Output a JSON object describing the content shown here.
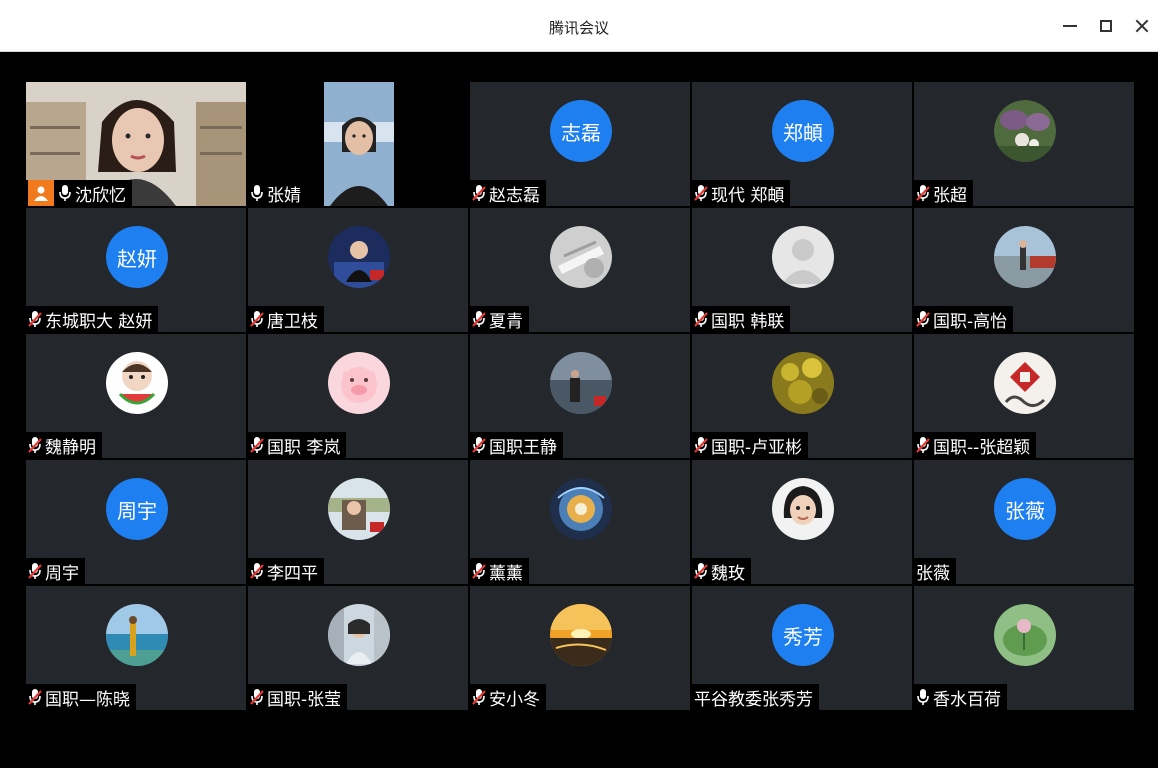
{
  "window": {
    "title": "腾讯会议"
  },
  "participants": [
    {
      "name": "沈欣忆",
      "mic": "on",
      "host": true,
      "video": true,
      "avatar_type": "video"
    },
    {
      "name": "张婧",
      "mic": "on",
      "host": false,
      "video": true,
      "avatar_type": "video"
    },
    {
      "name": "赵志磊",
      "mic": "muted",
      "avatar_type": "text",
      "avatar_text": "志磊"
    },
    {
      "name": "现代 郑頔",
      "mic": "muted",
      "avatar_type": "text",
      "avatar_text": "郑頔"
    },
    {
      "name": "张超",
      "mic": "muted",
      "avatar_type": "photo",
      "photo": "flowers"
    },
    {
      "name": "东城职大 赵妍",
      "mic": "muted",
      "avatar_type": "text",
      "avatar_text": "赵妍"
    },
    {
      "name": "唐卫枝",
      "mic": "muted",
      "avatar_type": "photo",
      "photo": "presenter"
    },
    {
      "name": "夏青",
      "mic": "muted",
      "avatar_type": "photo",
      "photo": "grey-abstract"
    },
    {
      "name": "国职 韩联",
      "mic": "muted",
      "avatar_type": "photo",
      "photo": "default-person"
    },
    {
      "name": "国职-高怡",
      "mic": "muted",
      "avatar_type": "photo",
      "photo": "seaside-walk"
    },
    {
      "name": "魏静明",
      "mic": "muted",
      "avatar_type": "photo",
      "photo": "child-watermelon"
    },
    {
      "name": "国职 李岚",
      "mic": "muted",
      "avatar_type": "photo",
      "photo": "cartoon-pig"
    },
    {
      "name": "国职王静",
      "mic": "muted",
      "avatar_type": "photo",
      "photo": "lake-person"
    },
    {
      "name": " 国职-卢亚彬",
      "mic": "muted",
      "avatar_type": "photo",
      "photo": "yellow-leaves"
    },
    {
      "name": "国职--张超颖",
      "mic": "muted",
      "avatar_type": "photo",
      "photo": "red-seal"
    },
    {
      "name": "周宇",
      "mic": "muted",
      "avatar_type": "text",
      "avatar_text": "周宇"
    },
    {
      "name": "李四平",
      "mic": "muted",
      "avatar_type": "photo",
      "photo": "selfie-beach"
    },
    {
      "name": "薰薰",
      "mic": "muted",
      "avatar_type": "photo",
      "photo": "cosmic-swirl"
    },
    {
      "name": "魏玫",
      "mic": "muted",
      "avatar_type": "photo",
      "photo": "child-portrait"
    },
    {
      "name": "张薇",
      "mic": "none",
      "avatar_type": "text",
      "avatar_text": "张薇"
    },
    {
      "name": "国职—陈晓",
      "mic": "muted",
      "avatar_type": "photo",
      "photo": "sea-coast"
    },
    {
      "name": "国职-张莹",
      "mic": "muted",
      "avatar_type": "photo",
      "photo": "woman-street"
    },
    {
      "name": "安小冬",
      "mic": "muted",
      "avatar_type": "photo",
      "photo": "sunset"
    },
    {
      "name": "平谷教委张秀芳",
      "mic": "none",
      "avatar_type": "text",
      "avatar_text": "秀芳"
    },
    {
      "name": "香水百荷",
      "mic": "on",
      "avatar_type": "photo",
      "photo": "lotus-leaf"
    }
  ],
  "colors": {
    "tile_bg": "#24272c",
    "text_avatar": "#1e7ff0",
    "host_badge": "#f07a1c",
    "mute_red": "#e53935"
  }
}
